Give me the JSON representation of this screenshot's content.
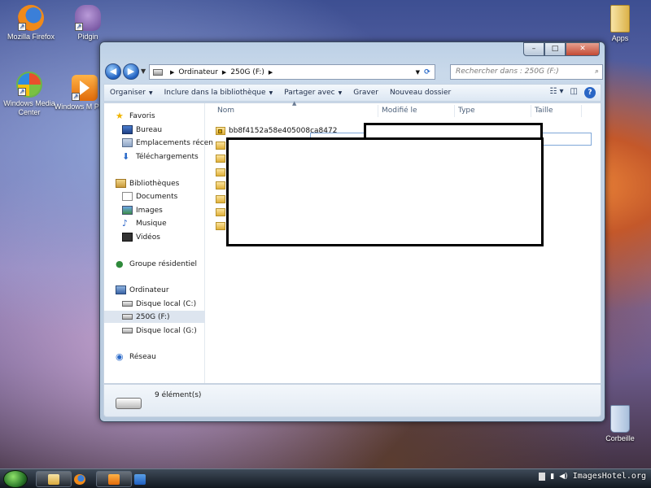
{
  "desktop": {
    "icons": [
      {
        "label": "Mozilla Firefox"
      },
      {
        "label": "Pidgin"
      },
      {
        "label": "Windows Media Center"
      },
      {
        "label": "Windows M Player"
      },
      {
        "label": "Apps"
      },
      {
        "label": "Corbeille"
      }
    ]
  },
  "window": {
    "buttons": {
      "minimize": "–",
      "maximize": "□",
      "close": "✕"
    },
    "address": {
      "crumbs": [
        "Ordinateur",
        "250G (F:)"
      ],
      "search_placeholder": "Rechercher dans : 250G (F:)"
    },
    "toolbar": {
      "organize": "Organiser",
      "include": "Inclure dans la bibliothèque",
      "share": "Partager avec",
      "burn": "Graver",
      "new_folder": "Nouveau dossier"
    },
    "sidebar": {
      "favorites": "Favoris",
      "desktop": "Bureau",
      "recent": "Emplacements récen",
      "downloads": "Téléchargements",
      "libraries": "Bibliothèques",
      "documents": "Documents",
      "images": "Images",
      "music": "Musique",
      "videos": "Vidéos",
      "homegroup": "Groupe résidentiel",
      "computer": "Ordinateur",
      "disk_c": "Disque local (C:)",
      "disk_f": "250G (F:)",
      "disk_g": "Disque local (G:)",
      "network": "Réseau"
    },
    "columns": {
      "name": "Nom",
      "modified": "Modifié le",
      "type": "Type",
      "size": "Taille"
    },
    "files": [
      {
        "name": "bb8f4152a58e405008ca8472"
      }
    ],
    "details": {
      "count": "9 élément(s)"
    }
  },
  "taskbar": {
    "watermark": "ImagesHotel.org"
  }
}
